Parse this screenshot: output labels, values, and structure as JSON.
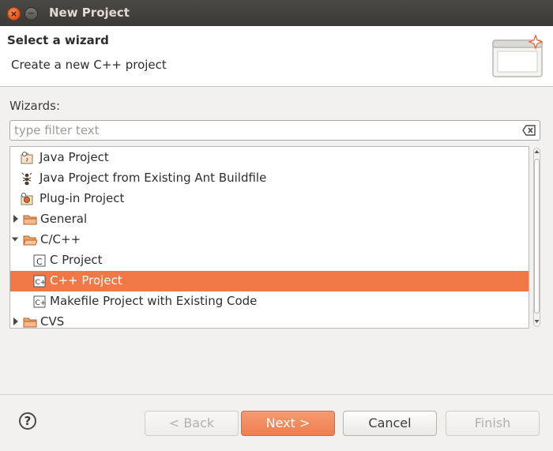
{
  "window": {
    "title": "New Project",
    "close_glyph": "×",
    "minimize_glyph": "−"
  },
  "header": {
    "title": "Select a wizard",
    "description": "Create a new C++ project",
    "banner_icon": "wizard-banner-icon"
  },
  "wizards": {
    "label": "Wizards:",
    "filter_placeholder": "type filter text",
    "filter_value": "",
    "items": [
      {
        "label": "Java Project",
        "icon": "java-project-icon",
        "level": 0,
        "expander": "none",
        "selected": false
      },
      {
        "label": "Java Project from Existing Ant Buildfile",
        "icon": "ant-icon",
        "level": 0,
        "expander": "none",
        "selected": false
      },
      {
        "label": "Plug-in Project",
        "icon": "plugin-project-icon",
        "level": 0,
        "expander": "none",
        "selected": false
      },
      {
        "label": "General",
        "icon": "folder-icon",
        "level": 0,
        "expander": "collapsed",
        "selected": false
      },
      {
        "label": "C/C++",
        "icon": "folder-open-icon",
        "level": 0,
        "expander": "expanded",
        "selected": false
      },
      {
        "label": "C Project",
        "icon": "c-project-icon",
        "level": 1,
        "expander": "none",
        "selected": false
      },
      {
        "label": "C++ Project",
        "icon": "cpp-project-icon",
        "level": 1,
        "expander": "none",
        "selected": true
      },
      {
        "label": "Makefile Project with Existing Code",
        "icon": "makefile-project-icon",
        "level": 1,
        "expander": "none",
        "selected": false
      },
      {
        "label": "CVS",
        "icon": "folder-icon",
        "level": 0,
        "expander": "collapsed",
        "selected": false
      }
    ]
  },
  "footer": {
    "help_glyph": "?",
    "buttons": {
      "back": "< Back",
      "next": "Next >",
      "cancel": "Cancel",
      "finish": "Finish"
    }
  },
  "colors": {
    "selection": "#f07746",
    "titlebar": "#3c3b37",
    "close_button": "#e1541b",
    "background": "#f2f1f0"
  }
}
